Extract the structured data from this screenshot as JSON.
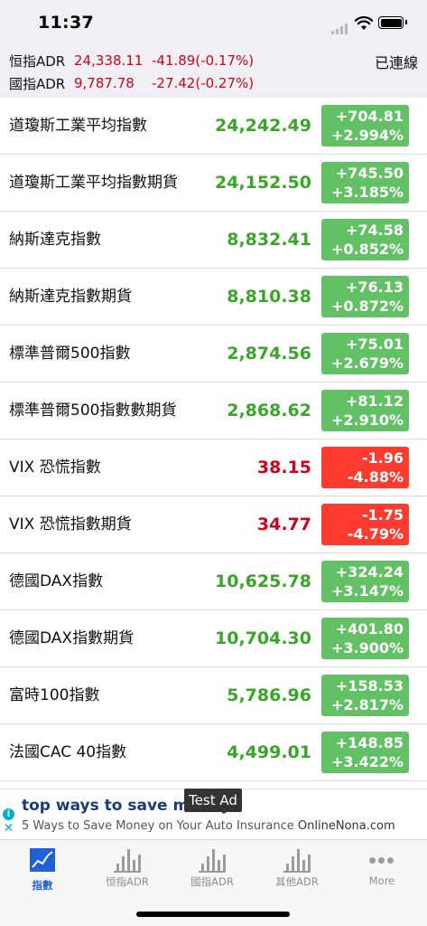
{
  "status_bar": {
    "time": "11:37"
  },
  "header": {
    "connection_status": "已連線",
    "adr": [
      {
        "name": "恒指ADR",
        "value": "24,338.11",
        "change": "-41.89(-0.17%)"
      },
      {
        "name": "國指ADR",
        "value": "9,787.78",
        "change": "-27.42(-0.27%)"
      }
    ]
  },
  "indices": [
    {
      "name": "道瓊斯工業平均指數",
      "price": "24,242.49",
      "change": "+704.81",
      "percent": "+2.994%",
      "trend": "up"
    },
    {
      "name": "道瓊斯工業平均指數期貨",
      "price": "24,152.50",
      "change": "+745.50",
      "percent": "+3.185%",
      "trend": "up"
    },
    {
      "name": "納斯達克指數",
      "price": "8,832.41",
      "change": "+74.58",
      "percent": "+0.852%",
      "trend": "up"
    },
    {
      "name": "納斯達克指數期貨",
      "price": "8,810.38",
      "change": "+76.13",
      "percent": "+0.872%",
      "trend": "up"
    },
    {
      "name": "標準普爾500指數",
      "price": "2,874.56",
      "change": "+75.01",
      "percent": "+2.679%",
      "trend": "up"
    },
    {
      "name": "標準普爾500指數數期貨",
      "price": "2,868.62",
      "change": "+81.12",
      "percent": "+2.910%",
      "trend": "up"
    },
    {
      "name": "VIX 恐慌指數",
      "price": "38.15",
      "change": "-1.96",
      "percent": "-4.88%",
      "trend": "down"
    },
    {
      "name": "VIX 恐慌指數期貨",
      "price": "34.77",
      "change": "-1.75",
      "percent": "-4.79%",
      "trend": "down"
    },
    {
      "name": "德國DAX指數",
      "price": "10,625.78",
      "change": "+324.24",
      "percent": "+3.147%",
      "trend": "up"
    },
    {
      "name": "德國DAX指數期貨",
      "price": "10,704.30",
      "change": "+401.80",
      "percent": "+3.900%",
      "trend": "up"
    },
    {
      "name": "富時100指數",
      "price": "5,786.96",
      "change": "+158.53",
      "percent": "+2.817%",
      "trend": "up"
    },
    {
      "name": "法國CAC 40指數",
      "price": "4,499.01",
      "change": "+148.85",
      "percent": "+3.422%",
      "trend": "up"
    }
  ],
  "ad": {
    "tag": "Test Ad",
    "title": "top ways to save money",
    "description": "5 Ways to Save Money on Your Auto Insurance",
    "source": "OnlineNona.com"
  },
  "tabs": [
    {
      "label": "指數",
      "icon": "line-chart-icon",
      "active": true
    },
    {
      "label": "恒指ADR",
      "icon": "bar-chart-icon",
      "active": false
    },
    {
      "label": "國指ADR",
      "icon": "bar-chart-icon",
      "active": false
    },
    {
      "label": "其他ADR",
      "icon": "bar-chart-icon",
      "active": false
    },
    {
      "label": "More",
      "icon": "more-dots-icon",
      "active": false
    }
  ],
  "colors": {
    "up_text": "#3aa629",
    "down_text": "#d0021b",
    "up_badge": "#62c165",
    "down_badge": "#ff3b30",
    "active_tab": "#2060d8"
  }
}
